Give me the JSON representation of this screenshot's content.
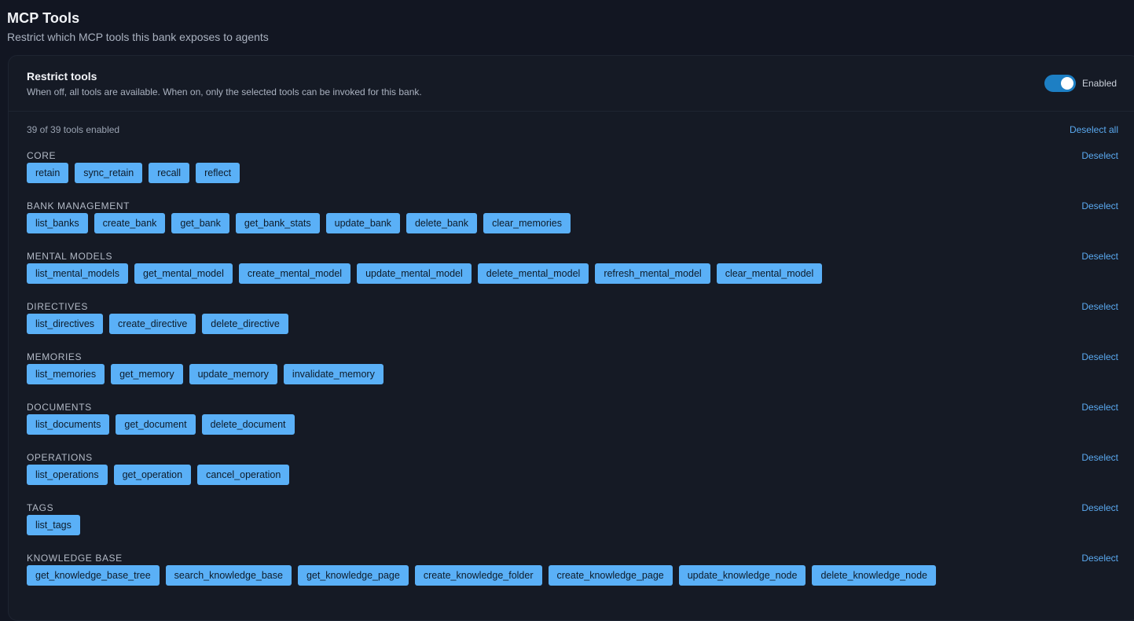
{
  "header": {
    "title": "MCP Tools",
    "subtitle": "Restrict which MCP tools this bank exposes to agents"
  },
  "restrict": {
    "title": "Restrict tools",
    "description": "When off, all tools are available. When on, only the selected tools can be invoked for this bank.",
    "toggle_label": "Enabled",
    "toggle_on": true,
    "accent_color": "#1d7fc4"
  },
  "summary": {
    "count_text": "39 of 39 tools enabled",
    "deselect_all_label": "Deselect all"
  },
  "deselect_label": "Deselect",
  "sections": [
    {
      "title": "CORE",
      "tools": [
        "retain",
        "sync_retain",
        "recall",
        "reflect"
      ]
    },
    {
      "title": "BANK MANAGEMENT",
      "tools": [
        "list_banks",
        "create_bank",
        "get_bank",
        "get_bank_stats",
        "update_bank",
        "delete_bank",
        "clear_memories"
      ]
    },
    {
      "title": "MENTAL MODELS",
      "tools": [
        "list_mental_models",
        "get_mental_model",
        "create_mental_model",
        "update_mental_model",
        "delete_mental_model",
        "refresh_mental_model",
        "clear_mental_model"
      ]
    },
    {
      "title": "DIRECTIVES",
      "tools": [
        "list_directives",
        "create_directive",
        "delete_directive"
      ]
    },
    {
      "title": "MEMORIES",
      "tools": [
        "list_memories",
        "get_memory",
        "update_memory",
        "invalidate_memory"
      ]
    },
    {
      "title": "DOCUMENTS",
      "tools": [
        "list_documents",
        "get_document",
        "delete_document"
      ]
    },
    {
      "title": "OPERATIONS",
      "tools": [
        "list_operations",
        "get_operation",
        "cancel_operation"
      ]
    },
    {
      "title": "TAGS",
      "tools": [
        "list_tags"
      ]
    },
    {
      "title": "KNOWLEDGE BASE",
      "tools": [
        "get_knowledge_base_tree",
        "search_knowledge_base",
        "get_knowledge_page",
        "create_knowledge_folder",
        "create_knowledge_page",
        "update_knowledge_node",
        "delete_knowledge_node"
      ]
    }
  ]
}
